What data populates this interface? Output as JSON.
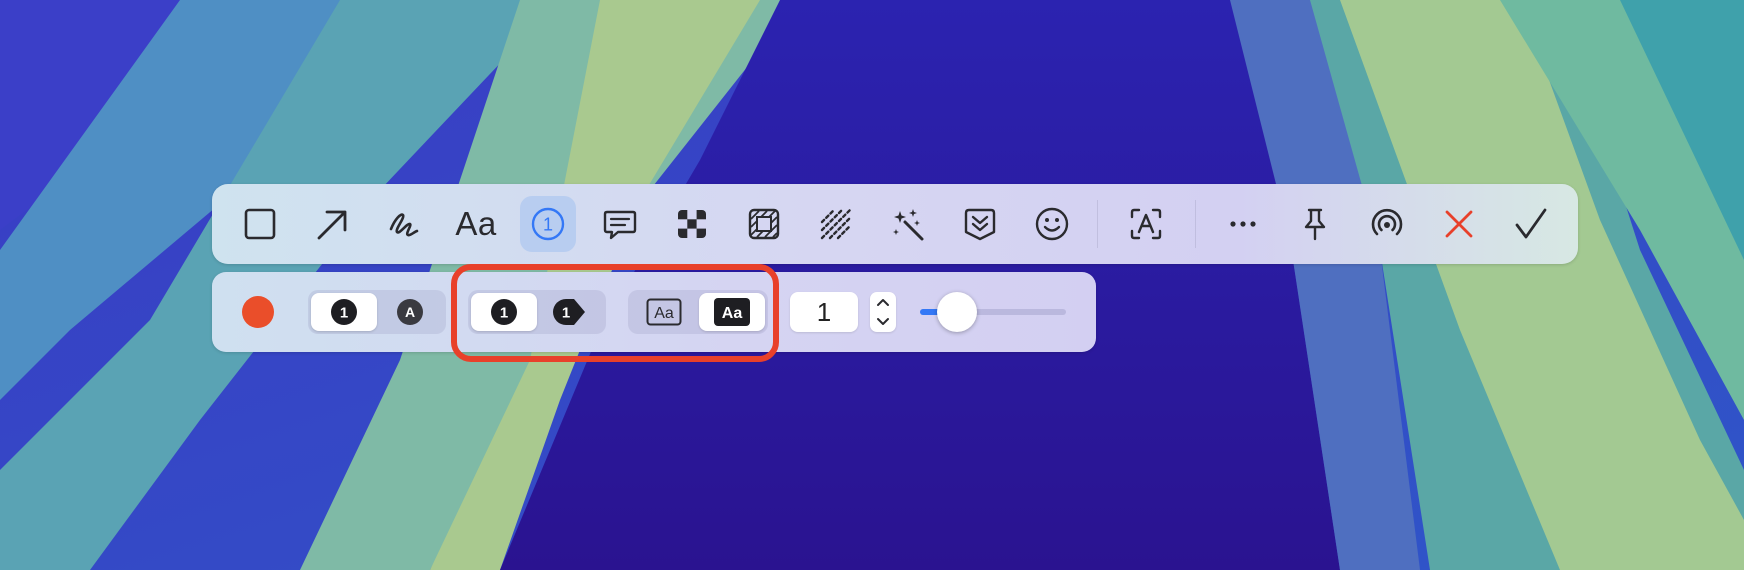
{
  "toolbar": {
    "tools": [
      {
        "name": "rectangle-tool",
        "icon": "square-icon"
      },
      {
        "name": "arrow-tool",
        "icon": "arrow-up-right-icon"
      },
      {
        "name": "draw-tool",
        "icon": "scribble-icon"
      },
      {
        "name": "text-tool",
        "icon": "text-icon",
        "label": "Aa"
      },
      {
        "name": "counter-tool",
        "icon": "numbered-circle-icon",
        "active": true
      },
      {
        "name": "comment-tool",
        "icon": "speech-bubble-icon"
      },
      {
        "name": "pixelate-tool",
        "icon": "checker-icon"
      },
      {
        "name": "blur-tool",
        "icon": "hatched-square-icon"
      },
      {
        "name": "highlight-tool",
        "icon": "diagonal-lines-icon"
      },
      {
        "name": "magic-tool",
        "icon": "magic-wand-icon"
      },
      {
        "name": "scroll-capture-tool",
        "icon": "chevrons-down-box-icon"
      },
      {
        "name": "emoji-tool",
        "icon": "smiley-icon"
      },
      {
        "name": "ocr-tool",
        "icon": "text-recognition-icon"
      },
      {
        "name": "more-button",
        "icon": "ellipsis-icon"
      },
      {
        "name": "pin-button",
        "icon": "pin-icon"
      },
      {
        "name": "share-button",
        "icon": "airdrop-icon"
      },
      {
        "name": "cancel-button",
        "icon": "close-icon"
      },
      {
        "name": "confirm-button",
        "icon": "checkmark-icon"
      }
    ]
  },
  "subbar": {
    "color": "#ea4e2a",
    "counter_style_a": "1",
    "counter_style_b": "A",
    "shape_round": "1",
    "shape_pin": "1",
    "text_outline_label": "Aa",
    "text_filled_label": "Aa",
    "start_value": "1",
    "size_level": 0.25
  },
  "colors": {
    "accent": "#3478f6",
    "highlight": "#e8402a",
    "cancel": "#e8402a"
  }
}
